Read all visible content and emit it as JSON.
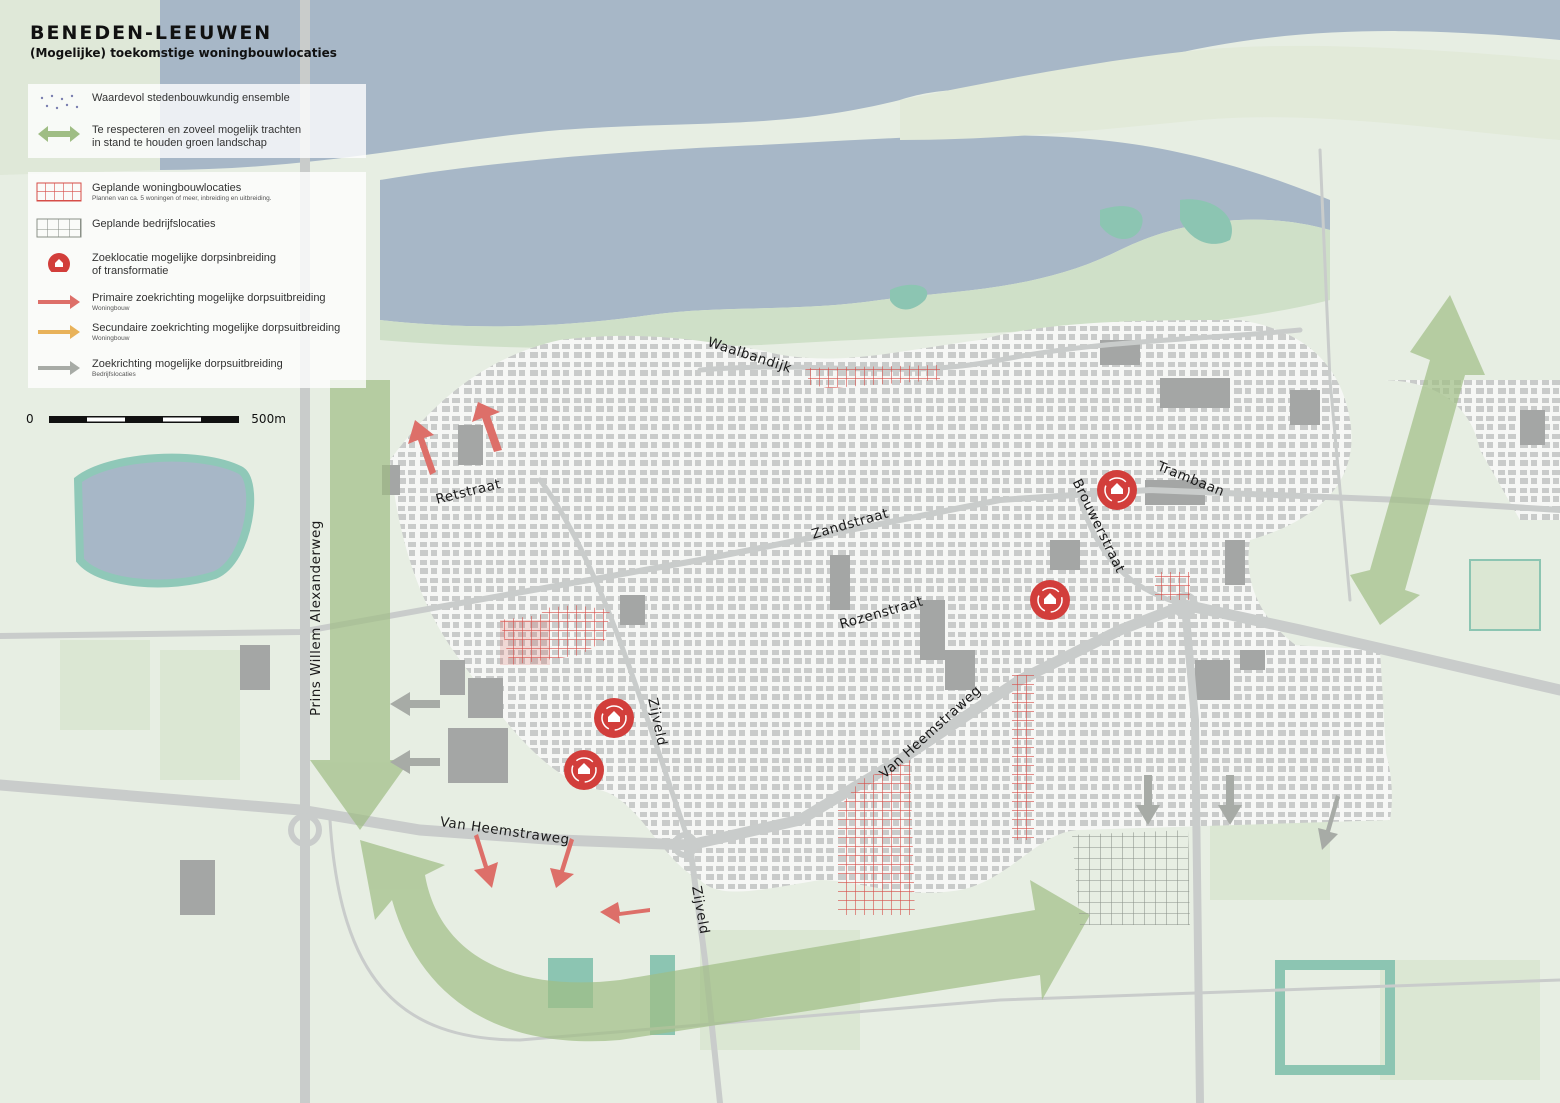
{
  "title": "BENEDEN-LEEUWEN",
  "subtitle": "(Mogelijke) toekomstige woningbouwlocaties",
  "legend": {
    "group1": [
      {
        "symbol": "dots-icon",
        "label": "Waardevol stedenbouwkundig ensemble"
      },
      {
        "symbol": "double-arrow-green-icon",
        "label": "Te respecteren en zoveel mogelijk trachten",
        "label2": "in stand te houden groen landschap"
      }
    ],
    "group2": [
      {
        "symbol": "red-grid-icon",
        "label": "Geplande woningbouwlocaties",
        "sub": "Plannen van ca. 5 woningen of meer, inbreiding en uitbreiding."
      },
      {
        "symbol": "grey-grid-icon",
        "label": "Geplande bedrijfslocaties"
      },
      {
        "symbol": "house-circle-icon",
        "label": "Zoeklocatie mogelijke dorpsinbreiding",
        "label2": "of transformatie"
      },
      {
        "symbol": "arrow-red-icon",
        "label": "Primaire zoekrichting mogelijke dorpsuitbreiding",
        "sub": "Woningbouw"
      },
      {
        "symbol": "arrow-orange-icon",
        "label": "Secundaire zoekrichting mogelijke dorpsuitbreiding",
        "sub": "Woningbouw"
      },
      {
        "symbol": "arrow-grey-icon",
        "label": "Zoekrichting mogelijke dorpsuitbreiding",
        "sub": "Bedrijfslocaties"
      }
    ]
  },
  "scale": {
    "start": "0",
    "end": "500m"
  },
  "streets": {
    "waalbandijk": "Waalbandijk",
    "retstraat": "Retstraat",
    "zandstraat": "Zandstraat",
    "rozenstraat": "Rozenstraat",
    "brouwerstraat": "Brouwerstraat",
    "trambaan": "Trambaan",
    "prins": "Prins Willem Alexanderweg",
    "zijveld1": "Zijveld",
    "zijveld2": "Zijveld",
    "heemstraweg1": "Van Heemstraweg",
    "heemstraweg2": "Van Heemstraweg"
  },
  "colors": {
    "water": "#a7b7c7",
    "field": "#dfe8d8",
    "green_arrow": "#9fbd84",
    "red": "#d95a55",
    "orange": "#e8b25a",
    "grey_arrow": "#a7aba6",
    "building": "#a4a6a5"
  }
}
